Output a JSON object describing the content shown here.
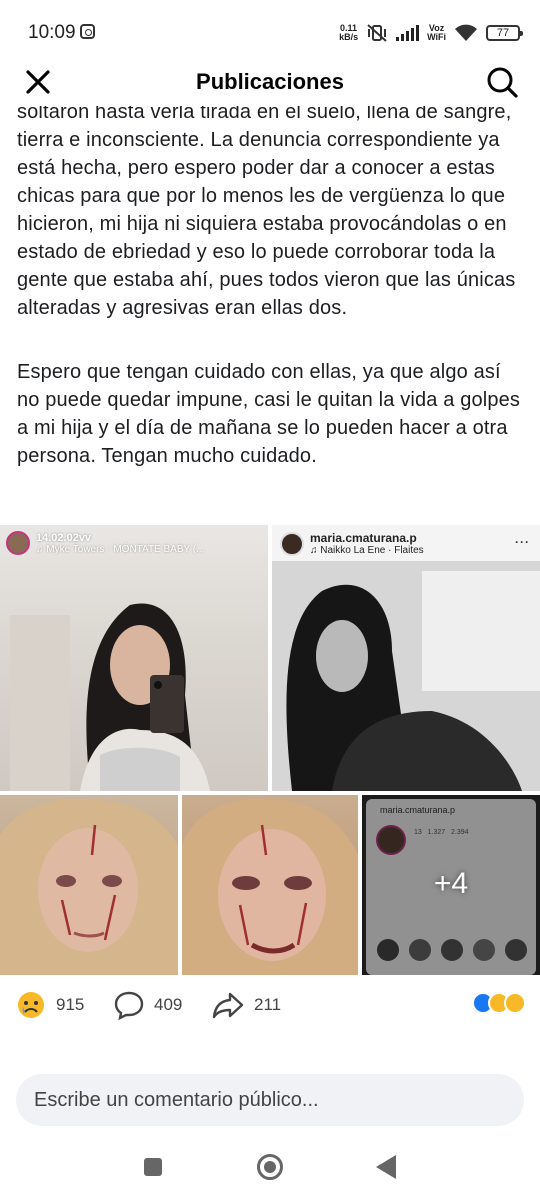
{
  "status_bar": {
    "time": "10:09",
    "net_speed_value": "0.11",
    "net_speed_unit": "kB/s",
    "voz_label": "Voz",
    "wifi_label": "WiFi",
    "battery": "77"
  },
  "header": {
    "title": "Publicaciones",
    "close_icon": "close-icon",
    "search_icon": "search-icon"
  },
  "post": {
    "paragraphs": [
      "soltaron hasta verla tirada en el suelo, llena de sangre, tierra e inconsciente. La denuncia correspondiente ya está hecha, pero espero poder dar a conocer a estas chicas para que por lo menos les de vergüenza lo que hicieron, mi hija ni siquiera estaba provocándolas o en estado de ebriedad y eso lo puede corroborar toda la gente que estaba ahí, pues todos vieron que las únicas alteradas y agresivas eran ellas dos.",
      "Espero que tengan cuidado con ellas, ya que algo así no puede quedar impune, casi le quitan la vida a golpes a mi hija y el día de mañana se lo pueden hacer a otra persona. Tengan mucho cuidado."
    ]
  },
  "media": {
    "tile1": {
      "username": "14.02.02vv",
      "song": "♫ Myke Towers · MÓNTATE BABY (..."
    },
    "tile2": {
      "username": "maria.cmaturana.p",
      "song": "♫ Naikko La Ene · Flaites",
      "menu": "···"
    },
    "tile5": {
      "username": "maria.cmaturana.p",
      "stats_posts": "13",
      "stats_followers": "1.327",
      "stats_following": "2.394",
      "more_count": "+4"
    }
  },
  "reactions": {
    "reaction_count": "915",
    "comment_count": "409",
    "share_count": "211"
  },
  "comment": {
    "placeholder": "Escribe un comentario público..."
  },
  "colors": {
    "accent_blue": "#1877f2",
    "reaction_yellow": "#f7b928",
    "text": "#1c1e21",
    "input_bg": "#f0f2f5"
  }
}
